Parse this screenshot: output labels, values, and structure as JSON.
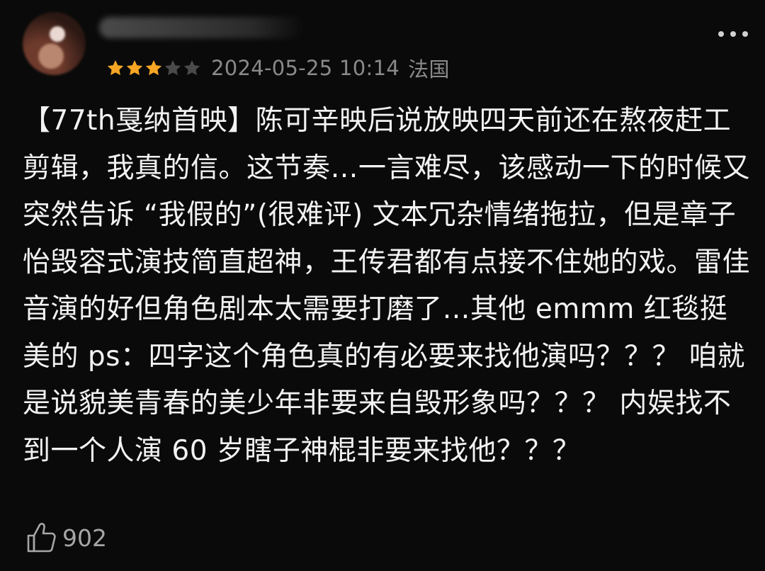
{
  "review": {
    "username": "",
    "rating": {
      "value": 3,
      "max": 5
    },
    "date": "2024-05-25 10:14",
    "location": "法国",
    "text": "【77th戛纳首映】陈可辛映后说放映四天前还在熬夜赶工剪辑，我真的信。这节奏…一言难尽，该感动一下的时候又突然告诉 “我假的”(很难评) 文本冗杂情绪拖拉，但是章子怡毁容式演技简直超神，王传君都有点接不住她的戏。雷佳音演的好但角色剧本太需要打磨了…其他 emmm 红毯挺美的 ps：四字这个角色真的有必要来找他演吗？？？ 咱就是说貌美青春的美少年非要来自毁形象吗？？？ 内娱找不到一个人演 60 岁瞎子神棍非要来找他？？？",
    "likes": "902"
  },
  "colors": {
    "star_filled": "#f6a623",
    "star_empty": "#4a4a4a",
    "meta_text": "#8a8a8a",
    "background": "#0a0a0a"
  },
  "icons": {
    "more": "more-dots-icon",
    "like": "thumbs-up-icon",
    "star": "star-icon"
  }
}
